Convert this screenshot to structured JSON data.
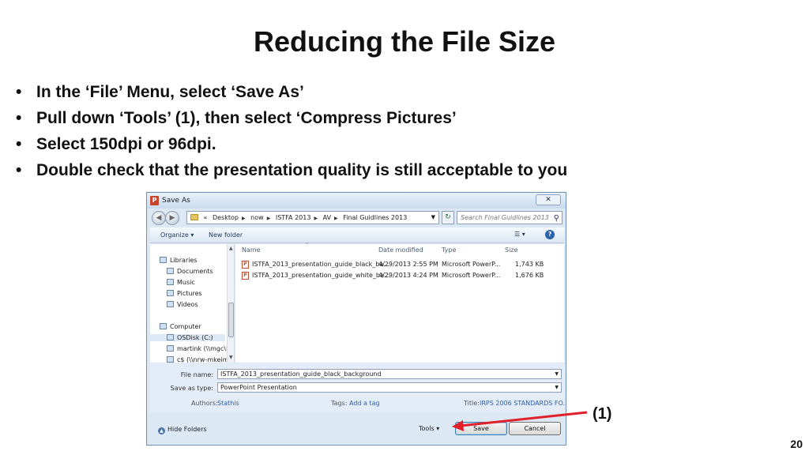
{
  "slide": {
    "title": "Reducing the File Size",
    "bullets": [
      "In the ‘File’ Menu, select ‘Save As’",
      "Pull down ‘Tools’ (1), then select ‘Compress Pictures’",
      "Select 150dpi or 96dpi.",
      "Double check that the presentation quality is still acceptable to you"
    ],
    "bullet_glyph": "•",
    "page_number": "20",
    "annotation_label": "(1)",
    "arrow_color": "#e0202a"
  },
  "dialog": {
    "title": "Save As",
    "app_icon": "P",
    "close_label": "✕",
    "address": {
      "prefix": "«",
      "crumbs": [
        "Desktop",
        "now",
        "ISTFA 2013",
        "AV",
        "Final Guidlines 2013"
      ]
    },
    "search_placeholder": "Search Final Guidlines 2013",
    "toolbar": {
      "organize": "Organize ▾",
      "new_folder": "New folder",
      "view": "☰ ▾",
      "help": "?"
    },
    "nav": {
      "libraries": "Libraries",
      "documents": "Documents",
      "music": "Music",
      "pictures": "Pictures",
      "videos": "Videos",
      "computer": "Computer",
      "osdisk": "OSDisk (C:)",
      "martink": "martink (\\\\mgc\\l",
      "cs": "c$ (\\\\nrw-mkeim"
    },
    "columns": {
      "name": "Name",
      "date": "Date modified",
      "type": "Type",
      "size": "Size"
    },
    "files": [
      {
        "name": "ISTFA_2013_presentation_guide_black_ba...",
        "date": "4/29/2013 2:55 PM",
        "type": "Microsoft PowerP...",
        "size": "1,743 KB"
      },
      {
        "name": "ISTFA_2013_presentation_guide_white_ba...",
        "date": "4/29/2013 4:24 PM",
        "type": "Microsoft PowerP...",
        "size": "1,676 KB"
      }
    ],
    "form": {
      "file_name_label": "File name:",
      "file_name_value": "ISTFA_2013_presentation_guide_black_background",
      "save_type_label": "Save as type:",
      "save_type_value": "PowerPoint Presentation",
      "authors_label": "Authors:",
      "authors_value": "Stathis",
      "tags_label": "Tags:",
      "tags_value": "Add a tag",
      "title_label": "Title:",
      "title_value": "IRPS 2006 STANDARDS FO..."
    },
    "footer": {
      "hide_folders": "Hide Folders",
      "tools": "Tools ▾",
      "save": "Save",
      "cancel": "Cancel"
    }
  }
}
